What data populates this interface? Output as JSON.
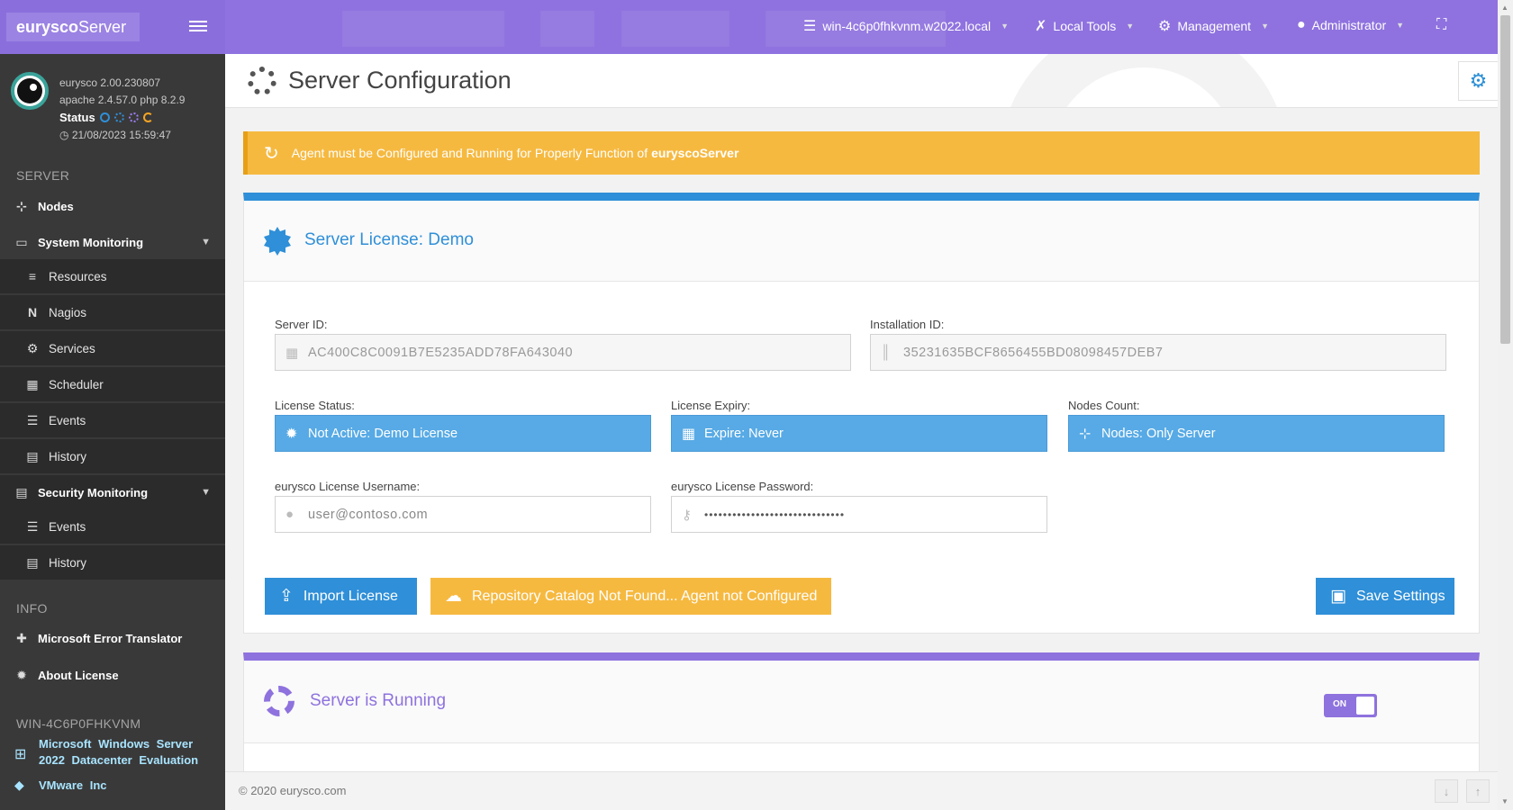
{
  "brand": {
    "name_bold": "eurysco",
    "name_rest": "Server"
  },
  "profile": {
    "version": "eurysco 2.00.230807",
    "stack": "apache 2.4.57.0  php 8.2.9",
    "status_label": "Status",
    "datetime": "21/08/2023 15:59:47",
    "status_colors": [
      "#2f8fd8",
      "#2f8fd8",
      "#9b7ef0",
      "#f6a623"
    ]
  },
  "sidebar": {
    "server_heading": "SERVER",
    "nodes": "Nodes",
    "system_monitoring": "System Monitoring",
    "sys_items": [
      "Resources",
      "Nagios",
      "Services",
      "Scheduler",
      "Events",
      "History"
    ],
    "security_monitoring": "Security Monitoring",
    "sec_items": [
      "Events",
      "History"
    ],
    "info_heading": "INFO",
    "error_translator": "Microsoft Error Translator",
    "about_license": "About License",
    "host_heading": "WIN-4C6P0FHKVNM",
    "os_line1": "Microsoft Windows Server",
    "os_line2": "2022 Datacenter Evaluation",
    "vendor": "VMware Inc"
  },
  "topbar": {
    "host": "win-4c6p0fhkvnm.w2022.local",
    "local_tools": "Local Tools",
    "management": "Management",
    "administrator": "Administrator"
  },
  "page": {
    "title": "Server Configuration",
    "alert_text": "Agent must be Configured and Running for Properly Function of",
    "alert_bold": "euryscoServer"
  },
  "license": {
    "panel_title": "Server License: Demo",
    "server_id_label": "Server ID:",
    "server_id": "AC400C8C0091B7E5235ADD78FA643040",
    "installation_id_label": "Installation ID:",
    "installation_id": "35231635BCF8656455BD08098457DEB7",
    "status_label": "License Status:",
    "status_value": "Not Active: Demo License",
    "expiry_label": "License Expiry:",
    "expiry_value": "Expire: Never",
    "nodes_label": "Nodes Count:",
    "nodes_value": "Nodes: Only Server",
    "username_label": "eurysco License Username:",
    "username_placeholder": "user@contoso.com",
    "password_label": "eurysco License Password:",
    "password_value": "••••••••••••••••••••••••••••••",
    "import_button": "Import License",
    "repo_button": "Repository Catalog Not Found... Agent not Configured",
    "save_button": "Save Settings"
  },
  "running": {
    "panel_title": "Server is Running",
    "toggle_label": "ON"
  },
  "footer": {
    "copyright": "© 2020   eurysco.com"
  }
}
